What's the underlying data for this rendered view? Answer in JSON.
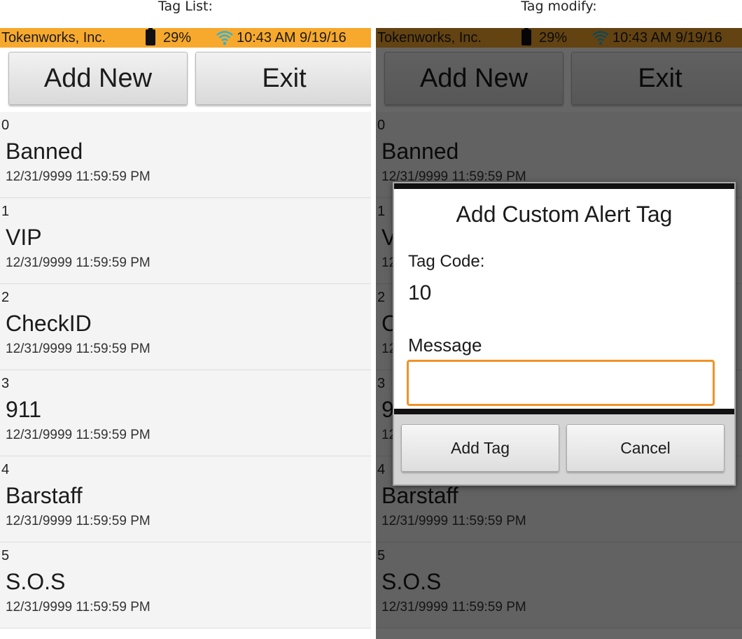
{
  "captions": {
    "left": "Tag List:",
    "right": "Tag modify:"
  },
  "status": {
    "company": "Tokenworks, Inc.",
    "battery": "29%",
    "time": "10:43 AM 9/19/16"
  },
  "toolbar": {
    "add_label": "Add New",
    "exit_label": "Exit"
  },
  "tags": [
    {
      "code": "0",
      "name": "Banned",
      "date": "12/31/9999 11:59:59 PM"
    },
    {
      "code": "1",
      "name": "VIP",
      "date": "12/31/9999 11:59:59 PM"
    },
    {
      "code": "2",
      "name": "CheckID",
      "date": "12/31/9999 11:59:59 PM"
    },
    {
      "code": "3",
      "name": "911",
      "date": "12/31/9999 11:59:59 PM"
    },
    {
      "code": "4",
      "name": "Barstaff",
      "date": "12/31/9999 11:59:59 PM"
    },
    {
      "code": "5",
      "name": "S.O.S",
      "date": "12/31/9999 11:59:59 PM"
    }
  ],
  "dialog": {
    "title": "Add Custom Alert Tag",
    "code_label": "Tag Code:",
    "code_value": "10",
    "message_label": "Message",
    "message_value": "",
    "add_label": "Add Tag",
    "cancel_label": "Cancel"
  },
  "colors": {
    "status_bar": "#f7a92d",
    "input_focus": "#f19226",
    "wifi": "#2bb3d6"
  }
}
